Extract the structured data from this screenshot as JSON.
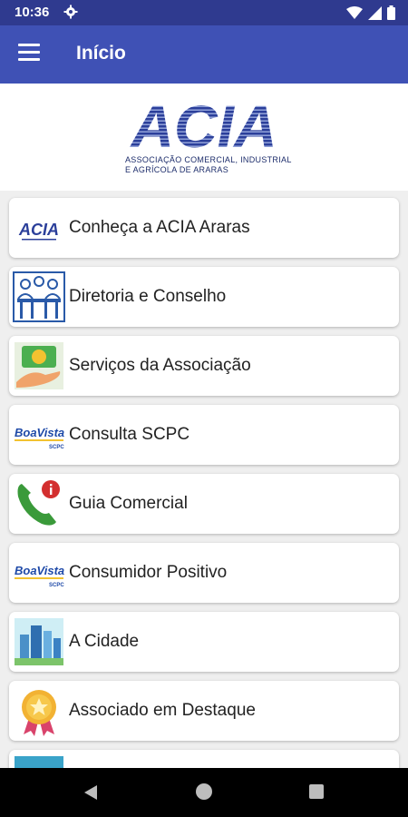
{
  "status_bar": {
    "time": "10:36"
  },
  "app_bar": {
    "title": "Início"
  },
  "header": {
    "logo_text": "ACIA",
    "logo_caption_line1": "ASSOCIAÇÃO COMERCIAL, INDUSTRIAL",
    "logo_caption_line2": "E AGRÍCOLA DE ARARAS"
  },
  "menu_items": [
    {
      "label": "Conheça a ACIA Araras",
      "icon": "acia-logo-icon"
    },
    {
      "label": "Diretoria e Conselho",
      "icon": "meeting-icon"
    },
    {
      "label": "Serviços da Associação",
      "icon": "money-hand-icon"
    },
    {
      "label": "Consulta SCPC",
      "icon": "boavista-logo-icon",
      "icon_text": "BoaVista",
      "icon_subtext": "SCPC"
    },
    {
      "label": "Guia Comercial",
      "icon": "phone-info-icon"
    },
    {
      "label": "Consumidor Positivo",
      "icon": "boavista-logo-icon",
      "icon_text": "BoaVista",
      "icon_subtext": "SCPC"
    },
    {
      "label": "A Cidade",
      "icon": "city-icon"
    },
    {
      "label": "Associado em Destaque",
      "icon": "star-medal-icon"
    },
    {
      "label": "",
      "icon": "handshake-icon"
    }
  ],
  "colors": {
    "status_bar": "#2f3a8f",
    "app_bar": "#3f51b5",
    "logo_blue": "#2b3f9a"
  }
}
